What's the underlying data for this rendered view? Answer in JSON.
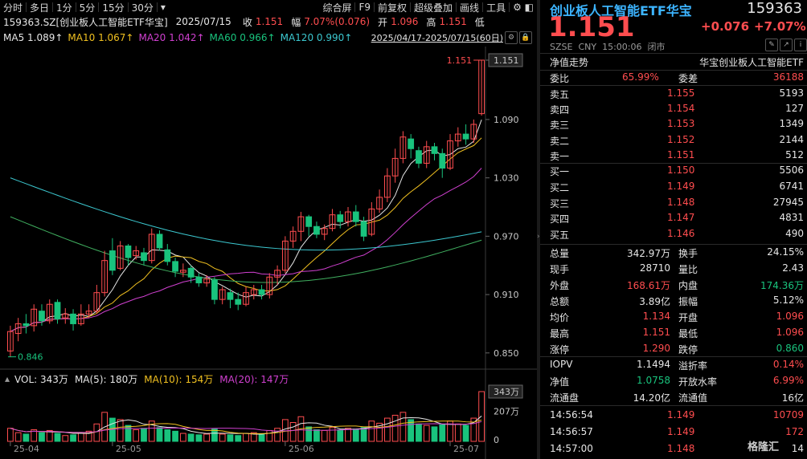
{
  "toolbar": {
    "left": [
      "分时",
      "多日",
      "1分",
      "5分",
      "15分",
      "30分"
    ],
    "dropdown": "▾",
    "right": [
      "综合屏",
      "F9",
      "前复权",
      "超级叠加",
      "画线",
      "工具"
    ]
  },
  "info": {
    "code_name": "159363.SZ[创业板人工智能ETF华宝]",
    "date": "2025/07/15",
    "close_label": "收",
    "close": "1.151",
    "change_label": "幅",
    "change": "7.07%(0.076)",
    "open_label": "开",
    "open": "1.096",
    "high_label": "高",
    "high": "1.151",
    "low_label": "低"
  },
  "ma": {
    "ma5": "MA5 1.089↑",
    "ma10": "MA10 1.067↑",
    "ma20": "MA20 1.042↑",
    "ma60": "MA60 0.966↑",
    "ma120": "MA120 0.990↑",
    "range": "2025/04/17-2025/07/15(60日)"
  },
  "annotations": {
    "high_marker": "1.151",
    "low_marker": "0.846",
    "current_price_tag": "1.151",
    "vol_tag": "343万"
  },
  "volume": {
    "label": "VOL: 343万",
    "ma5": "MA(5): 180万",
    "ma10": "MA(10): 154万",
    "ma20": "MA(20): 147万",
    "yticks": [
      "207万",
      "0"
    ]
  },
  "colors": {
    "up": "#ff4d4f",
    "down": "#19c37d",
    "ma5": "#e6e6e6",
    "ma10": "#f0c020",
    "ma20": "#d040d0",
    "ma60": "#3cc8d0",
    "ma120": "#40b060"
  },
  "chart_data": {
    "type": "candlestick",
    "title": "",
    "y_ticks": [
      1.151,
      1.09,
      1.03,
      0.97,
      0.91,
      0.85
    ],
    "y_tick_labels": [
      "1.151",
      "1.090",
      "1.030",
      "0.970",
      "0.910",
      "0.850"
    ],
    "ylim": [
      0.835,
      1.165
    ],
    "x_tick_labels": [
      "25-04",
      "25-05",
      "25-06",
      "25-07"
    ],
    "x_tick_index": [
      0,
      13,
      35,
      56
    ],
    "candles": [
      [
        0.852,
        0.872,
        0.846,
        0.878
      ],
      [
        0.87,
        0.88,
        0.862,
        0.886
      ],
      [
        0.88,
        0.878,
        0.87,
        0.89
      ],
      [
        0.878,
        0.895,
        0.872,
        0.9
      ],
      [
        0.893,
        0.883,
        0.878,
        0.9
      ],
      [
        0.883,
        0.9,
        0.88,
        0.905
      ],
      [
        0.902,
        0.885,
        0.88,
        0.905
      ],
      [
        0.886,
        0.89,
        0.88,
        0.896
      ],
      [
        0.89,
        0.88,
        0.873,
        0.895
      ],
      [
        0.88,
        0.89,
        0.878,
        0.9
      ],
      [
        0.89,
        0.893,
        0.886,
        0.9
      ],
      [
        0.893,
        0.912,
        0.89,
        0.92
      ],
      [
        0.912,
        0.945,
        0.908,
        0.955
      ],
      [
        0.955,
        0.935,
        0.93,
        0.968
      ],
      [
        0.937,
        0.96,
        0.935,
        0.965
      ],
      [
        0.96,
        0.948,
        0.94,
        0.962
      ],
      [
        0.95,
        0.955,
        0.946,
        0.96
      ],
      [
        0.953,
        0.945,
        0.94,
        0.958
      ],
      [
        0.945,
        0.972,
        0.942,
        0.978
      ],
      [
        0.972,
        0.958,
        0.955,
        0.976
      ],
      [
        0.956,
        0.944,
        0.94,
        0.962
      ],
      [
        0.944,
        0.934,
        0.928,
        0.948
      ],
      [
        0.933,
        0.935,
        0.928,
        0.942
      ],
      [
        0.937,
        0.928,
        0.922,
        0.94
      ],
      [
        0.928,
        0.922,
        0.918,
        0.932
      ],
      [
        0.922,
        0.926,
        0.918,
        0.93
      ],
      [
        0.925,
        0.905,
        0.9,
        0.928
      ],
      [
        0.905,
        0.915,
        0.9,
        0.918
      ],
      [
        0.912,
        0.905,
        0.896,
        0.916
      ],
      [
        0.905,
        0.9,
        0.894,
        0.912
      ],
      [
        0.9,
        0.912,
        0.898,
        0.918
      ],
      [
        0.91,
        0.915,
        0.905,
        0.92
      ],
      [
        0.915,
        0.91,
        0.905,
        0.92
      ],
      [
        0.91,
        0.928,
        0.906,
        0.932
      ],
      [
        0.928,
        0.935,
        0.92,
        0.94
      ],
      [
        0.935,
        0.965,
        0.932,
        0.97
      ],
      [
        0.965,
        0.975,
        0.958,
        0.98
      ],
      [
        0.975,
        0.99,
        0.965,
        0.995
      ],
      [
        0.99,
        0.98,
        0.97,
        0.992
      ],
      [
        0.98,
        0.972,
        0.968,
        0.985
      ],
      [
        0.972,
        0.978,
        0.966,
        0.982
      ],
      [
        0.978,
        0.992,
        0.975,
        0.998
      ],
      [
        0.992,
        0.985,
        0.978,
        0.996
      ],
      [
        0.985,
        0.995,
        0.98,
        1.0
      ],
      [
        0.995,
        0.985,
        0.98,
        1.002
      ],
      [
        0.985,
        0.97,
        0.965,
        0.99
      ],
      [
        0.972,
        0.998,
        0.97,
        1.005
      ],
      [
        0.998,
        1.01,
        0.994,
        1.018
      ],
      [
        1.01,
        1.032,
        1.005,
        1.04
      ],
      [
        1.032,
        1.05,
        1.025,
        1.06
      ],
      [
        1.05,
        1.072,
        1.045,
        1.078
      ],
      [
        1.07,
        1.06,
        1.05,
        1.075
      ],
      [
        1.058,
        1.045,
        1.04,
        1.062
      ],
      [
        1.045,
        1.062,
        1.04,
        1.068
      ],
      [
        1.062,
        1.055,
        1.048,
        1.066
      ],
      [
        1.055,
        1.04,
        1.03,
        1.06
      ],
      [
        1.04,
        1.068,
        1.038,
        1.075
      ],
      [
        1.068,
        1.075,
        1.062,
        1.082
      ],
      [
        1.075,
        1.07,
        1.064,
        1.085
      ],
      [
        1.07,
        1.085,
        1.066,
        1.09
      ],
      [
        1.096,
        1.151,
        1.094,
        1.151
      ]
    ],
    "volumes": [
      90,
      60,
      50,
      80,
      60,
      75,
      55,
      40,
      45,
      60,
      70,
      120,
      200,
      160,
      150,
      110,
      80,
      90,
      140,
      95,
      80,
      70,
      55,
      50,
      45,
      50,
      85,
      50,
      45,
      40,
      55,
      60,
      50,
      75,
      90,
      150,
      130,
      170,
      100,
      80,
      75,
      95,
      80,
      90,
      85,
      95,
      140,
      125,
      160,
      180,
      200,
      150,
      120,
      110,
      100,
      115,
      140,
      120,
      110,
      160,
      343
    ],
    "volumes_unit": "万",
    "volume_ylim": [
      0,
      343
    ],
    "ma_series": [
      {
        "name": "MA5",
        "values_start": [
          0.875,
          1.089
        ]
      },
      {
        "name": "MA10",
        "values_start": [
          0.88,
          1.067
        ]
      },
      {
        "name": "MA20",
        "values_start": [
          0.89,
          1.042
        ]
      },
      {
        "name": "MA60",
        "values_start": [
          0.99,
          0.966
        ]
      },
      {
        "name": "MA120",
        "values_start": [
          1.03,
          0.99
        ]
      }
    ]
  },
  "panel": {
    "title": "创业板人工智能ETF华宝",
    "code": "159363",
    "price": "1.151",
    "change": "+0.076",
    "change_pct": "+7.07%",
    "meta": "SZSE  CNY  15:00:06  闭市",
    "nav_label": "净值走势",
    "nav_name": "华宝创业板人工智能ETF",
    "weibi_label": "委比",
    "weibi": "65.99%",
    "weicha_label": "委差",
    "weicha": "36188",
    "asks": [
      {
        "label": "卖五",
        "price": "1.155",
        "vol": "5193"
      },
      {
        "label": "卖四",
        "price": "1.154",
        "vol": "127"
      },
      {
        "label": "卖三",
        "price": "1.153",
        "vol": "1349"
      },
      {
        "label": "卖二",
        "price": "1.152",
        "vol": "2144"
      },
      {
        "label": "卖一",
        "price": "1.151",
        "vol": "512"
      }
    ],
    "bids": [
      {
        "label": "买一",
        "price": "1.150",
        "vol": "5506"
      },
      {
        "label": "买二",
        "price": "1.149",
        "vol": "6741"
      },
      {
        "label": "买三",
        "price": "1.148",
        "vol": "27945"
      },
      {
        "label": "买四",
        "price": "1.147",
        "vol": "4831"
      },
      {
        "label": "买五",
        "price": "1.146",
        "vol": "490"
      }
    ],
    "stats": [
      {
        "l1": "总量",
        "v1": "342.97万",
        "c1": "white",
        "l2": "换手",
        "v2": "24.15%",
        "c2": "white"
      },
      {
        "l1": "现手",
        "v1": "28710",
        "c1": "white",
        "l2": "量比",
        "v2": "2.43",
        "c2": "white"
      },
      {
        "l1": "外盘",
        "v1": "168.61万",
        "c1": "red",
        "l2": "内盘",
        "v2": "174.36万",
        "c2": "green"
      },
      {
        "l1": "总额",
        "v1": "3.89亿",
        "c1": "white",
        "l2": "振幅",
        "v2": "5.12%",
        "c2": "white"
      },
      {
        "l1": "均价",
        "v1": "1.134",
        "c1": "red",
        "l2": "开盘",
        "v2": "1.096",
        "c2": "red"
      },
      {
        "l1": "最高",
        "v1": "1.151",
        "c1": "red",
        "l2": "最低",
        "v2": "1.096",
        "c2": "red"
      },
      {
        "l1": "涨停",
        "v1": "1.290",
        "c1": "red",
        "l2": "跌停",
        "v2": "0.860",
        "c2": "green"
      }
    ],
    "stats2": [
      {
        "l1": "IOPV",
        "v1": "1.1494",
        "c1": "white",
        "l2": "溢折率",
        "v2": "0.14%",
        "c2": "red"
      },
      {
        "l1": "净值",
        "v1": "1.0758",
        "c1": "green",
        "l2": "开放水率",
        "v2": "6.99%",
        "c2": "red"
      },
      {
        "l1": "流通盘",
        "v1": "14.20亿",
        "c1": "white",
        "l2": "流通值",
        "v2": "16亿",
        "c2": "white"
      }
    ],
    "ticks": [
      {
        "time": "14:56:54",
        "price": "1.149",
        "vol": "10709"
      },
      {
        "time": "14:56:57",
        "price": "1.149",
        "vol": "172"
      },
      {
        "time": "14:57:00",
        "price": "1.148",
        "vol": "14"
      }
    ],
    "watermark": "格隆汇"
  }
}
